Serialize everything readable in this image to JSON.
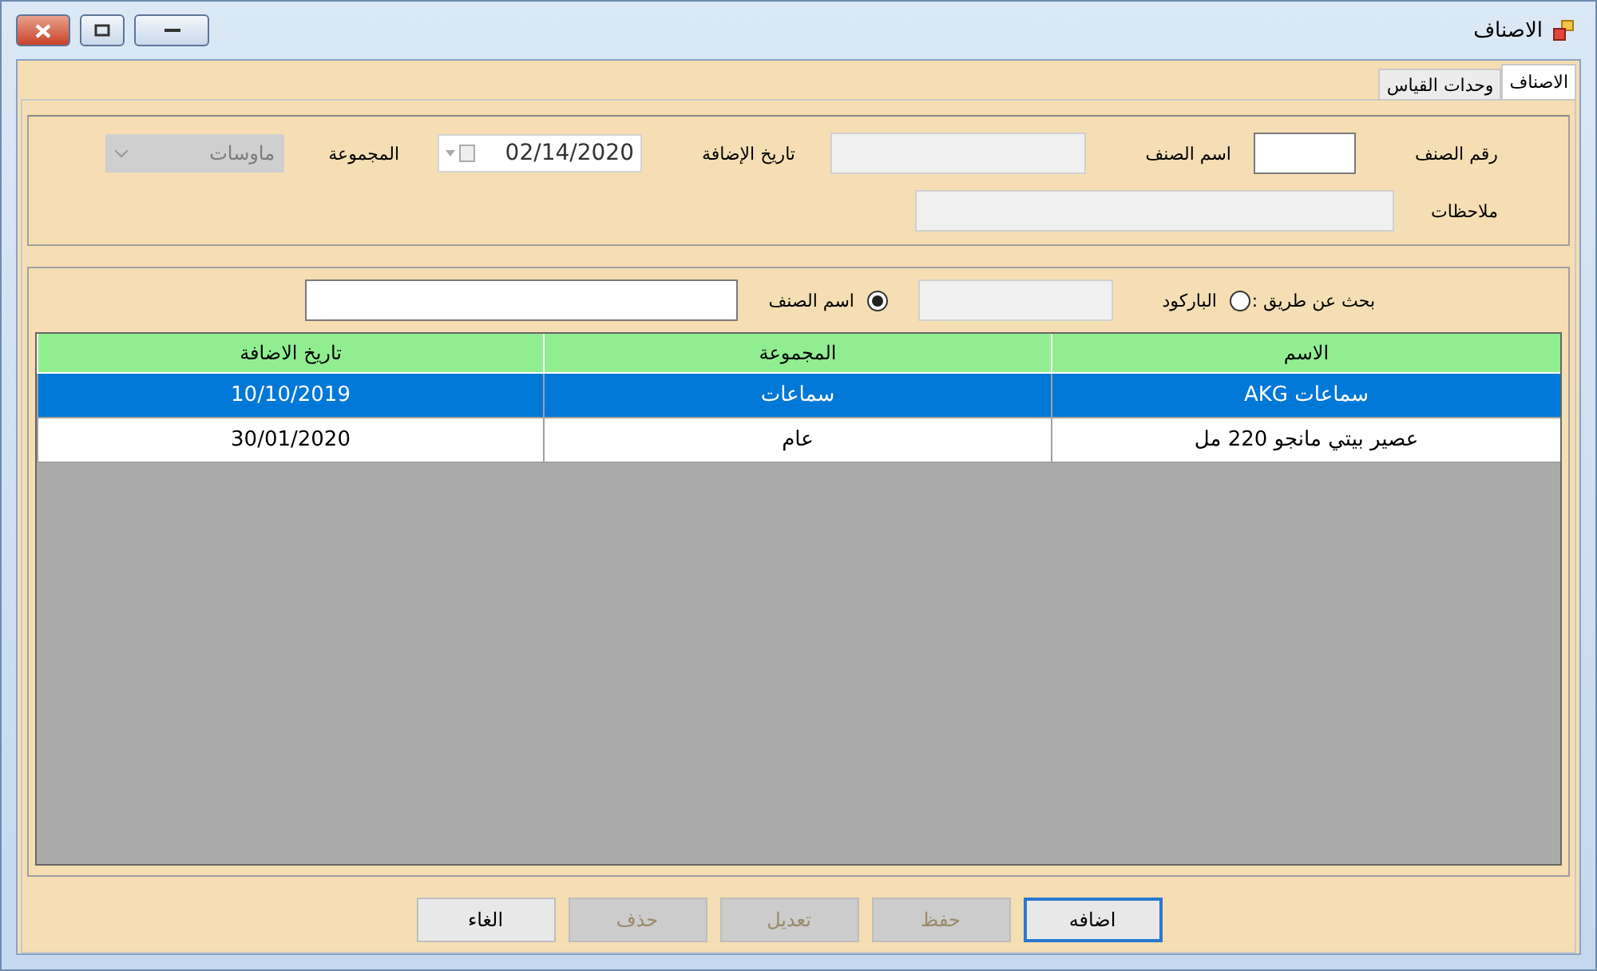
{
  "window": {
    "title": "الاصناف"
  },
  "tabs": [
    {
      "label": "الاصناف",
      "selected": true
    },
    {
      "label": "وحدات القياس",
      "selected": false
    }
  ],
  "details": {
    "item_number": {
      "label": "رقم الصنف",
      "disabled": false
    },
    "item_name": {
      "label": "اسم الصنف",
      "disabled": true
    },
    "date_added": {
      "label": "تاريخ الإضافة",
      "value": "02/14/2020"
    },
    "group": {
      "label": "المجموعة",
      "value": "ماوسات",
      "disabled": true
    },
    "notes": {
      "label": "ملاحظات",
      "disabled": true
    }
  },
  "search": {
    "label": "بحث عن طريق :",
    "options": [
      {
        "label": "الباركود",
        "selected": false
      },
      {
        "label": "اسم الصنف",
        "selected": true
      }
    ]
  },
  "table": {
    "columns": [
      "الاسم",
      "المجموعة",
      "تاريخ الاضافة"
    ],
    "rows": [
      {
        "cells": [
          "سماعات AKG",
          "سماعات",
          "10/10/2019"
        ],
        "selected": true
      },
      {
        "cells": [
          "عصير بيتي مانجو 220 مل",
          "عام",
          "30/01/2020"
        ],
        "selected": false
      }
    ]
  },
  "buttons": [
    {
      "label": "اضافه",
      "disabled": false,
      "focused": true
    },
    {
      "label": "حفظ",
      "disabled": true,
      "focused": false
    },
    {
      "label": "تعديل",
      "disabled": true,
      "focused": false
    },
    {
      "label": "حذف",
      "disabled": true,
      "focused": false
    },
    {
      "label": "الغاء",
      "disabled": false,
      "focused": false
    }
  ]
}
